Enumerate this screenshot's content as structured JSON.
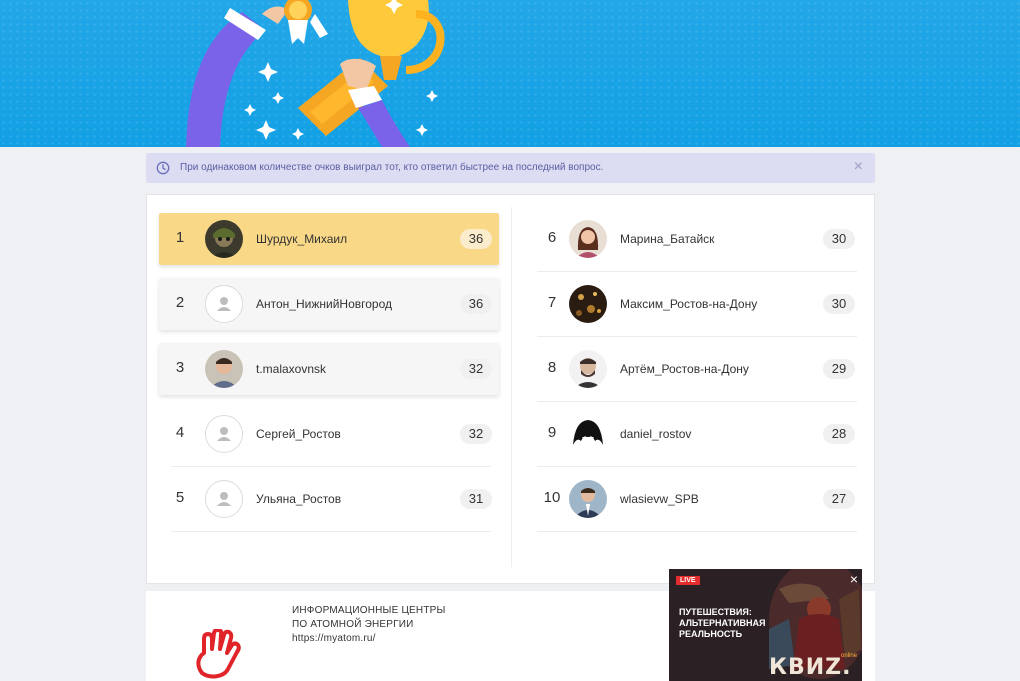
{
  "notice": {
    "text": "При одинаковом количестве очков выиграл тот, кто ответил быстрее на последний вопрос.",
    "close_icon": "×"
  },
  "leaderboard": {
    "left": [
      {
        "rank": "1",
        "name": "Шурдук_Михаил",
        "score": "36",
        "avatar": "photo"
      },
      {
        "rank": "2",
        "name": "Антон_НижнийНовгород",
        "score": "36",
        "avatar": "placeholder"
      },
      {
        "rank": "3",
        "name": "t.malaxovnsk",
        "score": "32",
        "avatar": "photo"
      },
      {
        "rank": "4",
        "name": "Сергей_Ростов",
        "score": "32",
        "avatar": "placeholder"
      },
      {
        "rank": "5",
        "name": "Ульяна_Ростов",
        "score": "31",
        "avatar": "placeholder"
      }
    ],
    "right": [
      {
        "rank": "6",
        "name": "Марина_Батайск",
        "score": "30",
        "avatar": "photo"
      },
      {
        "rank": "7",
        "name": "Максим_Ростов-на-Дону",
        "score": "30",
        "avatar": "photo"
      },
      {
        "rank": "8",
        "name": "Артём_Ростов-на-Дону",
        "score": "29",
        "avatar": "photo"
      },
      {
        "rank": "9",
        "name": "daniel_rostov",
        "score": "28",
        "avatar": "photo"
      },
      {
        "rank": "10",
        "name": "wlasievw_SPB",
        "score": "27",
        "avatar": "photo"
      }
    ]
  },
  "footer": {
    "line1": "ИНФОРМАЦИОННЫЕ ЦЕНТРЫ",
    "line2": "ПО АТОМНОЙ ЭНЕРГИИ",
    "line3": "https://myatom.ru/"
  },
  "ad": {
    "live": "LIVE",
    "title_line1": "ПУТЕШЕСТВИЯ:",
    "title_line2": "АЛЬТЕРНАТИВНАЯ",
    "title_line3": "РЕАЛЬНОСТЬ",
    "brand": "КВИZ.",
    "brand_small": "online",
    "close_icon": "×"
  },
  "colors": {
    "hero_blue": "#12a0e4",
    "first_place": "#f9d888",
    "notice_bg": "#dcdcf2",
    "notice_text": "#5b5ea3"
  }
}
